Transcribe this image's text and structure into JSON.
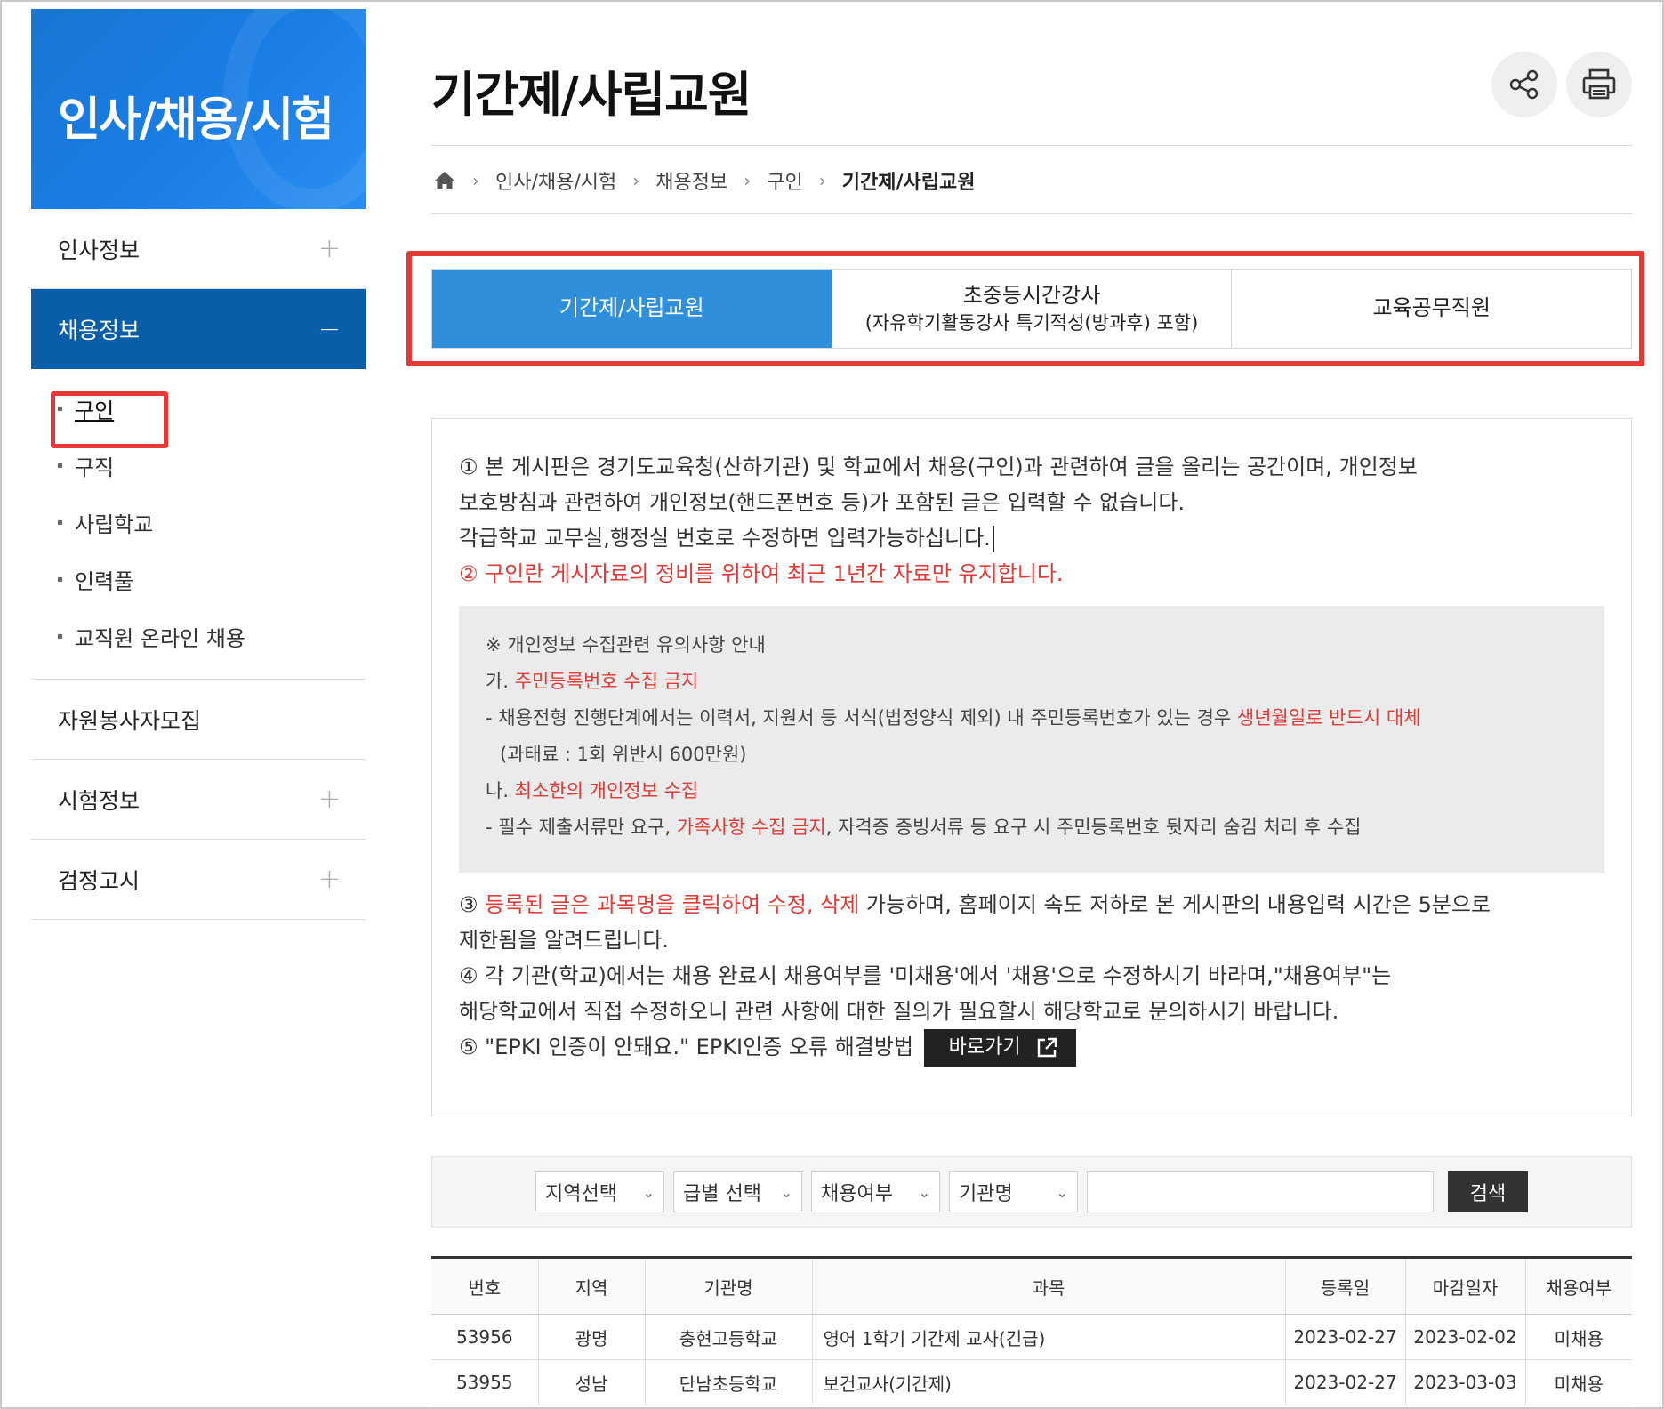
{
  "sidebar": {
    "banner_title": "인사/채용/시험",
    "items": [
      {
        "label": "인사정보",
        "toggle": "+"
      },
      {
        "label": "채용정보",
        "toggle": "−"
      },
      {
        "label": "자원봉사자모집",
        "toggle": ""
      },
      {
        "label": "시험정보",
        "toggle": "+"
      },
      {
        "label": "검정고시",
        "toggle": "+"
      }
    ],
    "sub_items": [
      {
        "label": "구인"
      },
      {
        "label": "구직"
      },
      {
        "label": "사립학교"
      },
      {
        "label": "인력풀"
      },
      {
        "label": "교직원 온라인 채용"
      }
    ]
  },
  "header": {
    "title": "기간제/사립교원",
    "share_icon": "share-icon",
    "print_icon": "print-icon"
  },
  "breadcrumb": [
    "인사/채용/시험",
    "채용정보",
    "구인",
    "기간제/사립교원"
  ],
  "tabs": [
    {
      "label": "기간제/사립교원",
      "sub": ""
    },
    {
      "label": "초중등시간강사",
      "sub": "(자유학기활동강사 특기적성(방과후) 포함)"
    },
    {
      "label": "교육공무직원",
      "sub": ""
    }
  ],
  "notice": {
    "p1_l1": "① 본 게시판은 경기도교육청(산하기관) 및 학교에서 채용(구인)과 관련하여 글을 올리는 공간이며, 개인정보",
    "p1_l2": "보호방침과 관련하여 개인정보(핸드폰번호 등)가 포함된 글은 입력할 수 없습니다.",
    "p1_l3": "각급학교 교무실,행정실 번호로 수정하면 입력가능하십니다.",
    "p2_num": "② ",
    "p2_red": "구인란 게시자료의 정비를 위하여 최근 1년간 자료만 유지합니다.",
    "box": {
      "title": "※ 개인정보 수집관련 유의사항 안내",
      "a_prefix": "가. ",
      "a_red": "주민등록번호 수집 금지",
      "a_desc_text": "- 채용전형 진행단계에서는 이력서, 지원서 등 서식(법정양식 제외) 내 주민등록번호가 있는 경우 ",
      "a_desc_red": "생년월일로 반드시 대체",
      "a_fine": "(과태료 : 1회 위반시 600만원)",
      "b_prefix": "나. ",
      "b_red": "최소한의 개인정보 수집",
      "b_desc_1": "- 필수 제출서류만 요구, ",
      "b_desc_red": "가족사항 수집 금지",
      "b_desc_2": ", 자격증 증빙서류 등 요구 시 주민등록번호 뒷자리 숨김 처리 후 수집"
    },
    "p3_num": "③ ",
    "p3_red": "등록된 글은 과목명을 클릭하여 수정, 삭제",
    "p3_rest": " 가능하며, 홈페이지 속도 저하로 본 게시판의 내용입력 시간은 5분으로",
    "p3_l2": "제한됨을 알려드립니다.",
    "p4_l1": "④ 각 기관(학교)에서는 채용 완료시 채용여부를 '미채용'에서 '채용'으로 수정하시기 바라며,\"채용여부\"는",
    "p4_l2": "해당학교에서 직접 수정하오니 관련 사항에 대한 질의가 필요할시 해당학교로 문의하시기 바랍니다.",
    "p5": "⑤ \"EPKI 인증이 안돼요.\" EPKI인증 오류 해결방법",
    "go_label": "바로가기"
  },
  "search": {
    "region": "지역선택",
    "grade": "급별 선택",
    "hired": "채용여부",
    "org": "기관명",
    "query": "",
    "button": "검색"
  },
  "table": {
    "headers": [
      "번호",
      "지역",
      "기관명",
      "과목",
      "등록일",
      "마감일자",
      "채용여부"
    ],
    "rows": [
      [
        "53956",
        "광명",
        "충현고등학교",
        "영어 1학기 기간제 교사(긴급)",
        "2023-02-27",
        "2023-02-02",
        "미채용"
      ],
      [
        "53955",
        "성남",
        "단남초등학교",
        "보건교사(기간제)",
        "2023-02-27",
        "2023-03-03",
        "미채용"
      ]
    ]
  },
  "colors": {
    "banner": "#1a7ee6",
    "active_menu": "#0a5ea8",
    "active_tab": "#2f8fdb",
    "highlight": "#e53935"
  }
}
